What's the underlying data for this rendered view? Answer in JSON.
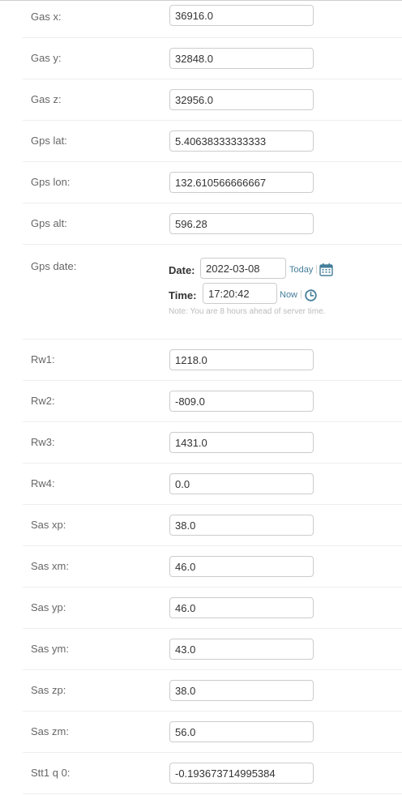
{
  "fields": [
    {
      "label": "Gas x:",
      "value": "36916.0"
    },
    {
      "label": "Gas y:",
      "value": "32848.0"
    },
    {
      "label": "Gas z:",
      "value": "32956.0"
    },
    {
      "label": "Gps lat:",
      "value": "5.40638333333333"
    },
    {
      "label": "Gps lon:",
      "value": "132.610566666667"
    },
    {
      "label": "Gps alt:",
      "value": "596.28"
    }
  ],
  "gps_date": {
    "label": "Gps date:",
    "date_label": "Date:",
    "date_value": "2022-03-08",
    "today_link": "Today",
    "time_label": "Time:",
    "time_value": "17:20:42",
    "now_link": "Now",
    "separator": "|",
    "help_text": "Note: You are 8 hours ahead of server time.",
    "icon_color": "#447e9b"
  },
  "fields2": [
    {
      "label": "Rw1:",
      "value": "1218.0"
    },
    {
      "label": "Rw2:",
      "value": "-809.0"
    },
    {
      "label": "Rw3:",
      "value": "1431.0"
    },
    {
      "label": "Rw4:",
      "value": "0.0"
    },
    {
      "label": "Sas xp:",
      "value": "38.0"
    },
    {
      "label": "Sas xm:",
      "value": "46.0"
    },
    {
      "label": "Sas yp:",
      "value": "46.0"
    },
    {
      "label": "Sas ym:",
      "value": "43.0"
    },
    {
      "label": "Sas zp:",
      "value": "38.0"
    },
    {
      "label": "Sas zm:",
      "value": "56.0"
    },
    {
      "label": "Stt1 q 0:",
      "value": "-0.193673714995384"
    }
  ]
}
